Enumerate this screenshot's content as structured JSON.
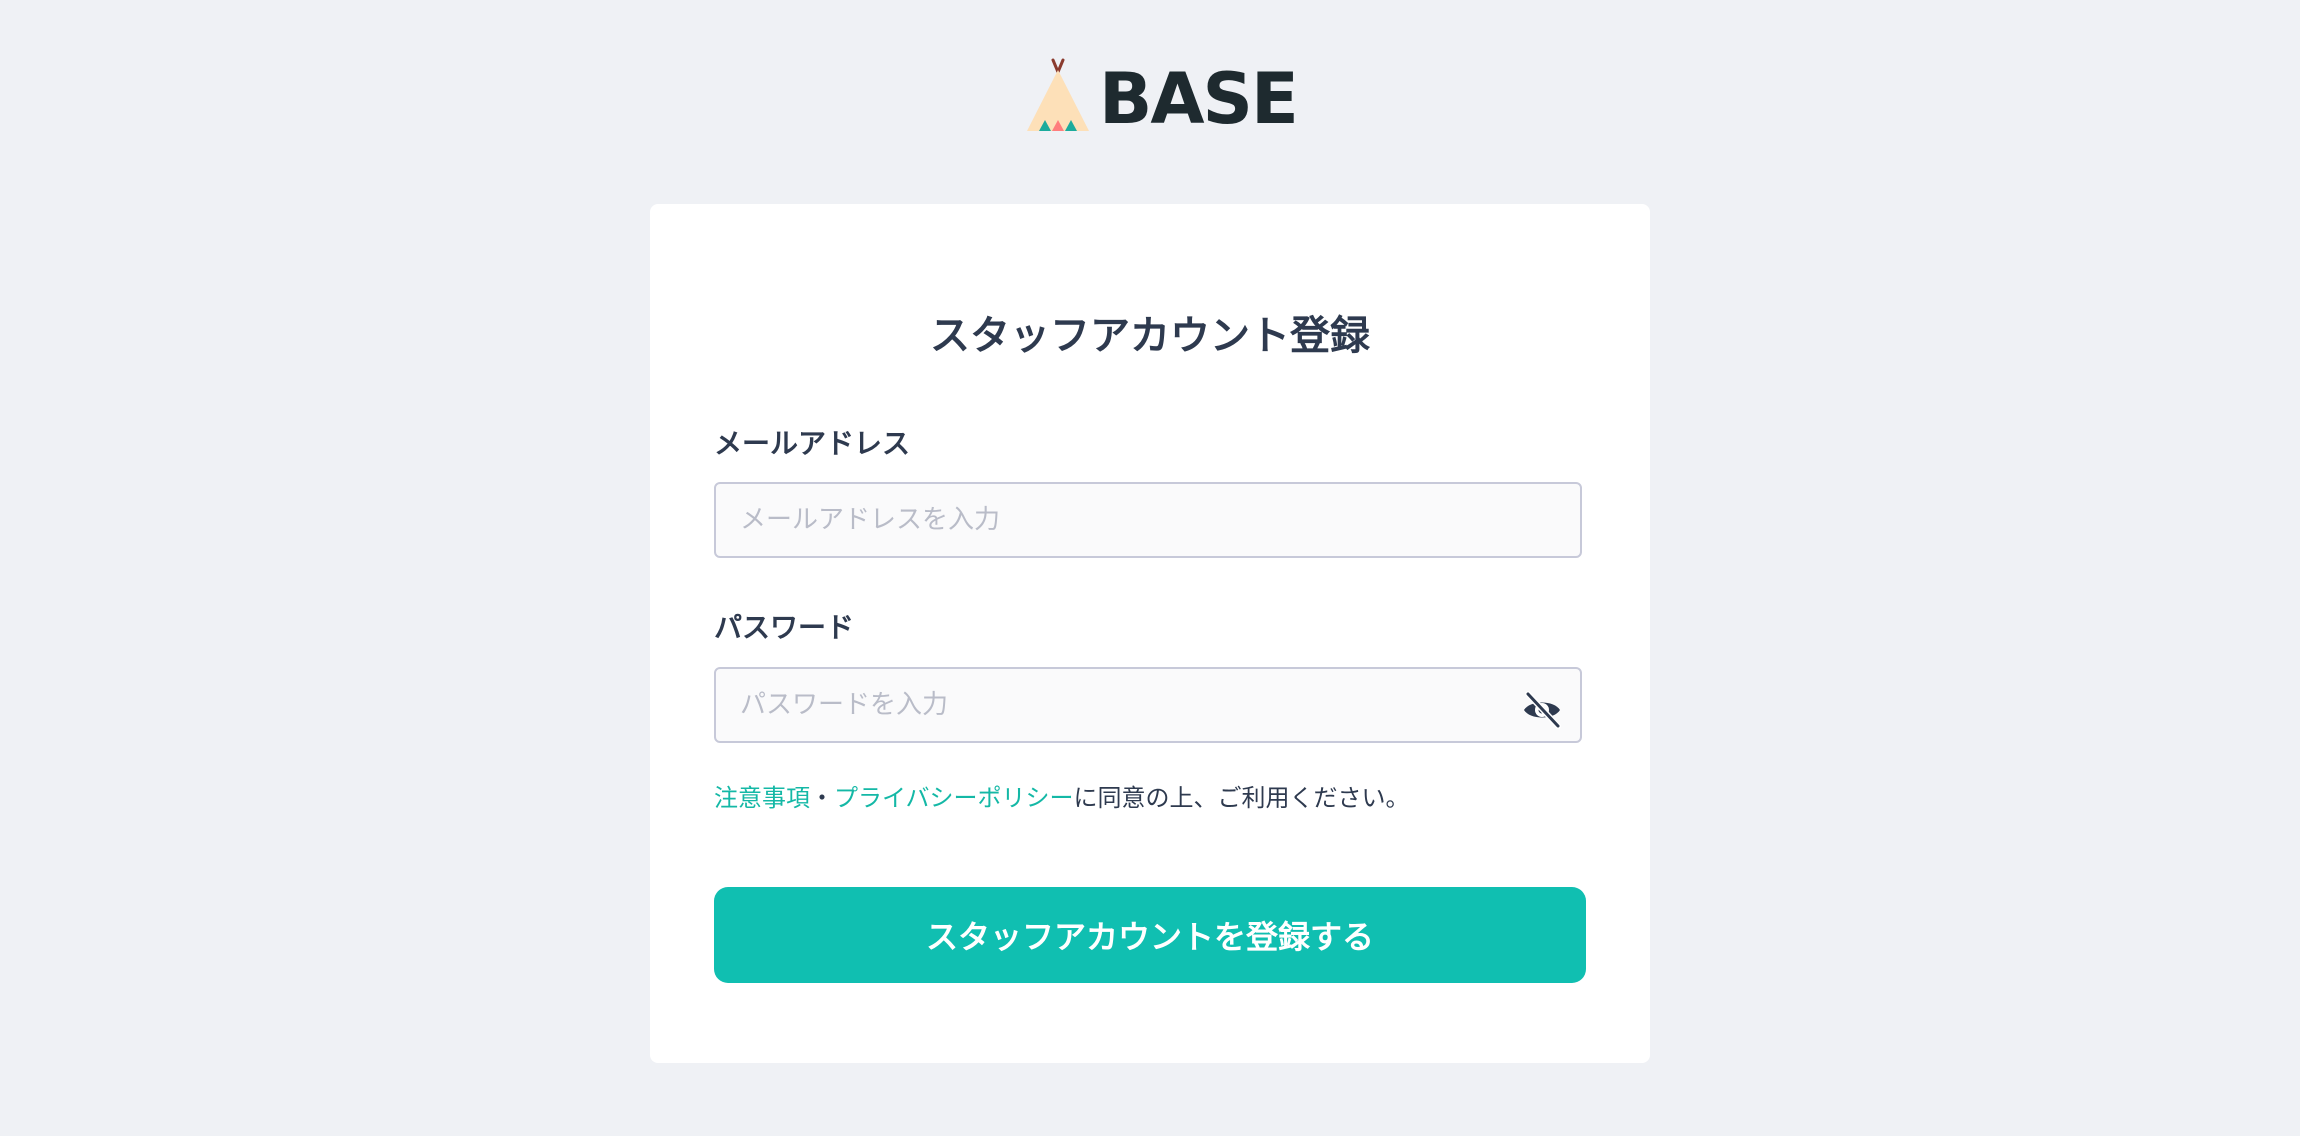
{
  "brand": {
    "name": "BASE",
    "logo_icon": "teepee-icon",
    "colors": {
      "accent": "#10bfb1",
      "link": "#14b8a6",
      "text": "#2e3a4f",
      "background": "#eff1f5"
    }
  },
  "form": {
    "title": "スタッフアカウント登録",
    "email": {
      "label": "メールアドレス",
      "placeholder": "メールアドレスを入力",
      "value": ""
    },
    "password": {
      "label": "パスワード",
      "placeholder": "パスワードを入力",
      "value": "",
      "toggle_icon": "eye-slash-icon"
    },
    "consent": {
      "link_notes": "注意事項",
      "separator": "・",
      "link_privacy": "プライバシーポリシー",
      "suffix": "に同意の上、ご利用ください。"
    },
    "submit_label": "スタッフアカウントを登録する"
  }
}
